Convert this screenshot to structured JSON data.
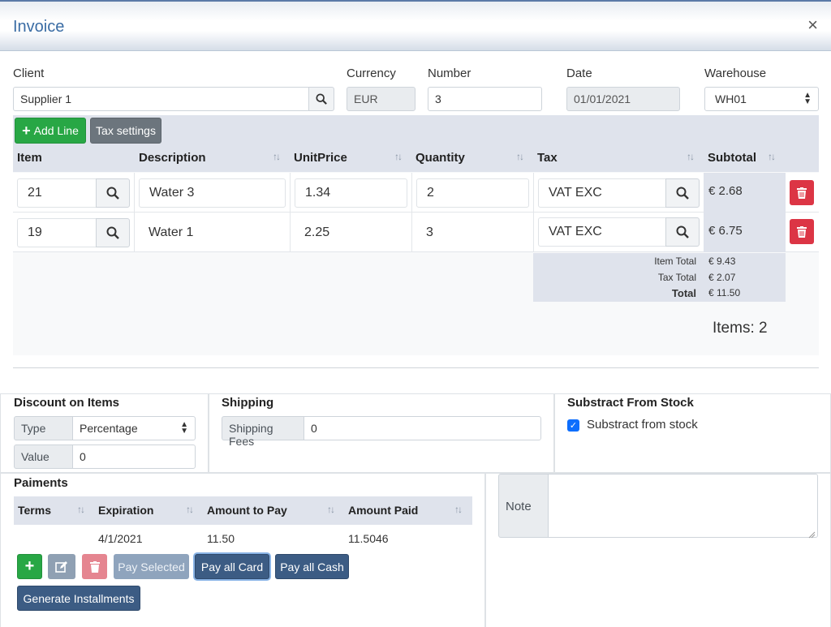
{
  "window": {
    "title": "Invoice",
    "close_label": "×"
  },
  "form": {
    "client": {
      "label": "Client",
      "value": "Supplier 1"
    },
    "currency": {
      "label": "Currency",
      "value": "EUR"
    },
    "number": {
      "label": "Number",
      "value": "3"
    },
    "date": {
      "label": "Date",
      "value": "01/01/2021"
    },
    "warehouse": {
      "label": "Warehouse",
      "value": "WH01"
    }
  },
  "toolbar": {
    "add_line_label": "Add Line",
    "tax_settings_label": "Tax settings"
  },
  "grid": {
    "columns": [
      "Item",
      "Description",
      "UnitPrice",
      "Quantity",
      "Tax",
      "Subtotal"
    ],
    "rows": [
      {
        "item": "21",
        "description": "Water 3",
        "unit_price": "1.34",
        "quantity": "2",
        "tax": "VAT EXC",
        "subtotal": "€ 2.68"
      },
      {
        "item": "19",
        "description": "Water 1",
        "unit_price": "2.25",
        "quantity": "3",
        "tax": "VAT EXC",
        "subtotal": "€ 6.75"
      }
    ],
    "totals": {
      "item_total_label": "Item Total",
      "item_total_value": "€ 9.43",
      "tax_total_label": "Tax Total",
      "tax_total_value": "€ 2.07",
      "total_label": "Total",
      "total_value": "€ 11.50"
    },
    "items_count": "Items: 2"
  },
  "discount": {
    "title": "Discount on Items",
    "type_label": "Type",
    "type_value": "Percentage",
    "value_label": "Value",
    "value_value": "0"
  },
  "shipping": {
    "title": "Shipping",
    "fees_label": "Shipping Fees",
    "fees_value": "0"
  },
  "stock": {
    "title": "Substract From Stock",
    "checkbox_label": "Substract from stock",
    "checked": true
  },
  "payments": {
    "title": "Paiments",
    "columns": [
      "Terms",
      "Expiration",
      "Amount to Pay",
      "Amount Paid"
    ],
    "rows": [
      {
        "terms": "",
        "expiration": "4/1/2021",
        "amount_to_pay": "11.50",
        "amount_paid": "11.5046"
      }
    ],
    "pay_selected_label": "Pay Selected",
    "pay_all_card_label": "Pay all Card",
    "pay_all_cash_label": "Pay all Cash",
    "generate_installments_label": "Generate Installments"
  },
  "note": {
    "label": "Note",
    "value": ""
  },
  "colors": {
    "primary": "#3c5c84",
    "success": "#28a745",
    "danger": "#dc3545",
    "header_bg": "#dfe3ec"
  }
}
